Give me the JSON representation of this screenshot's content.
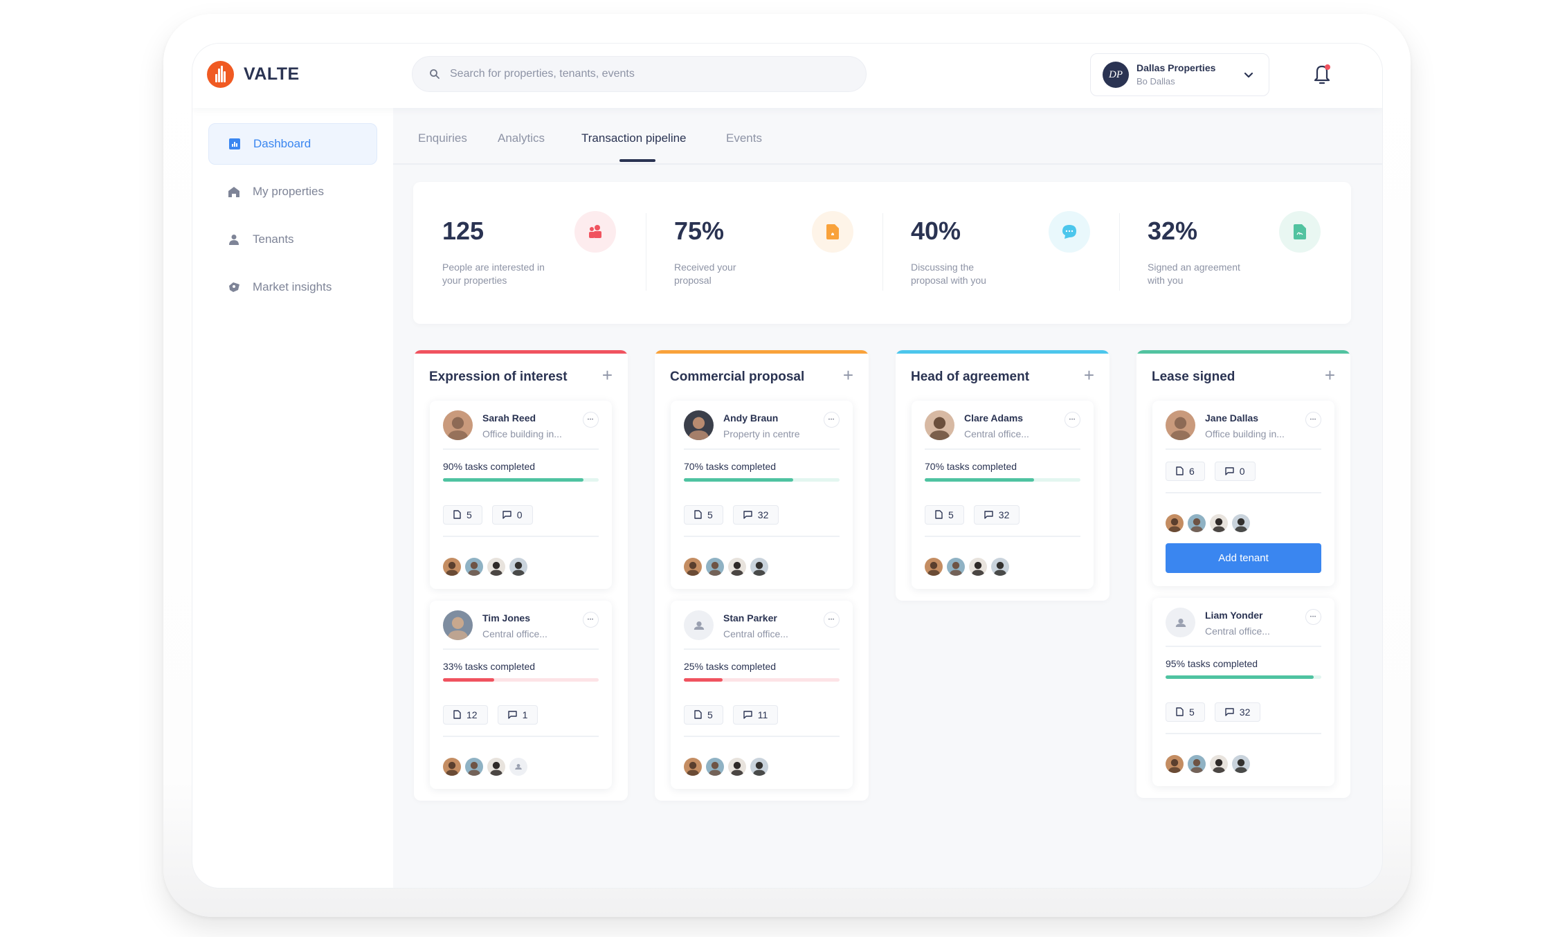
{
  "app": {
    "name": "VALTE",
    "brand_color": "#f05a22",
    "accent_color": "#3a86f0"
  },
  "search": {
    "placeholder": "Search for properties, tenants, events",
    "value": ""
  },
  "profile": {
    "initials": "DP",
    "company": "Dallas Properties",
    "user": "Bo Dallas"
  },
  "notifications": {
    "has_unread": true
  },
  "sidebar": {
    "items": [
      {
        "label": "Dashboard",
        "icon": "bar-chart-icon",
        "active": true
      },
      {
        "label": "My properties",
        "icon": "home-icon",
        "active": false
      },
      {
        "label": "Tenants",
        "icon": "user-icon",
        "active": false
      },
      {
        "label": "Market insights",
        "icon": "tag-icon",
        "active": false
      }
    ]
  },
  "tabs": [
    {
      "label": "Enquiries",
      "active": false
    },
    {
      "label": "Analytics",
      "active": false
    },
    {
      "label": "Transaction pipeline",
      "active": true
    },
    {
      "label": "Events",
      "active": false
    }
  ],
  "stats": [
    {
      "value": "125",
      "label": "People are interested in your properties",
      "icon": "people-icon",
      "color": "#f0535f",
      "bg": "#fdecee"
    },
    {
      "value": "75%",
      "label": "Received your proposal",
      "icon": "document-icon",
      "color": "#f9a23b",
      "bg": "#fef4e8"
    },
    {
      "value": "40%",
      "label": "Discussing the proposal with you",
      "icon": "chat-icon",
      "color": "#4cc6ec",
      "bg": "#e9f8fc"
    },
    {
      "value": "32%",
      "label": "Signed an agreement with you",
      "icon": "signed-document-icon",
      "color": "#52c3a0",
      "bg": "#e9f7f2"
    }
  ],
  "columns": [
    {
      "title": "Expression of interest",
      "color": "#f0535f",
      "cards": [
        {
          "name": "Sarah Reed",
          "subtitle": "Office building in...",
          "progress": 90,
          "progress_label": "90% tasks completed",
          "status": "good",
          "documents": "5",
          "comments": "0",
          "avatar": "photo",
          "team_size": 4
        },
        {
          "name": "Tim Jones",
          "subtitle": "Central office...",
          "progress": 33,
          "progress_label": "33% tasks completed",
          "status": "low",
          "documents": "12",
          "comments": "1",
          "avatar": "photo",
          "team_size": 4
        }
      ]
    },
    {
      "title": "Commercial proposal",
      "color": "#f9a23b",
      "cards": [
        {
          "name": "Andy Braun",
          "subtitle": "Property in centre",
          "progress": 70,
          "progress_label": "70% tasks completed",
          "status": "good",
          "documents": "5",
          "comments": "32",
          "avatar": "photo",
          "team_size": 4
        },
        {
          "name": "Stan Parker",
          "subtitle": "Central office...",
          "progress": 25,
          "progress_label": "25% tasks completed",
          "status": "low",
          "documents": "5",
          "comments": "11",
          "avatar": "placeholder",
          "team_size": 4
        }
      ]
    },
    {
      "title": "Head of agreement",
      "color": "#4cc6ec",
      "cards": [
        {
          "name": "Clare Adams",
          "subtitle": "Central office...",
          "progress": 70,
          "progress_label": "70% tasks completed",
          "status": "good",
          "documents": "5",
          "comments": "32",
          "avatar": "photo",
          "team_size": 4
        }
      ]
    },
    {
      "title": "Lease signed",
      "color": "#52c3a0",
      "cards": [
        {
          "name": "Jane Dallas",
          "subtitle": "Office building in...",
          "progress": null,
          "progress_label": null,
          "status": "good",
          "documents": "6",
          "comments": "0",
          "avatar": "photo",
          "team_size": 4,
          "action_label": "Add tenant"
        },
        {
          "name": "Liam Yonder",
          "subtitle": "Central office...",
          "progress": 95,
          "progress_label": "95% tasks completed",
          "status": "good",
          "documents": "5",
          "comments": "32",
          "avatar": "placeholder",
          "team_size": 4
        }
      ]
    }
  ]
}
